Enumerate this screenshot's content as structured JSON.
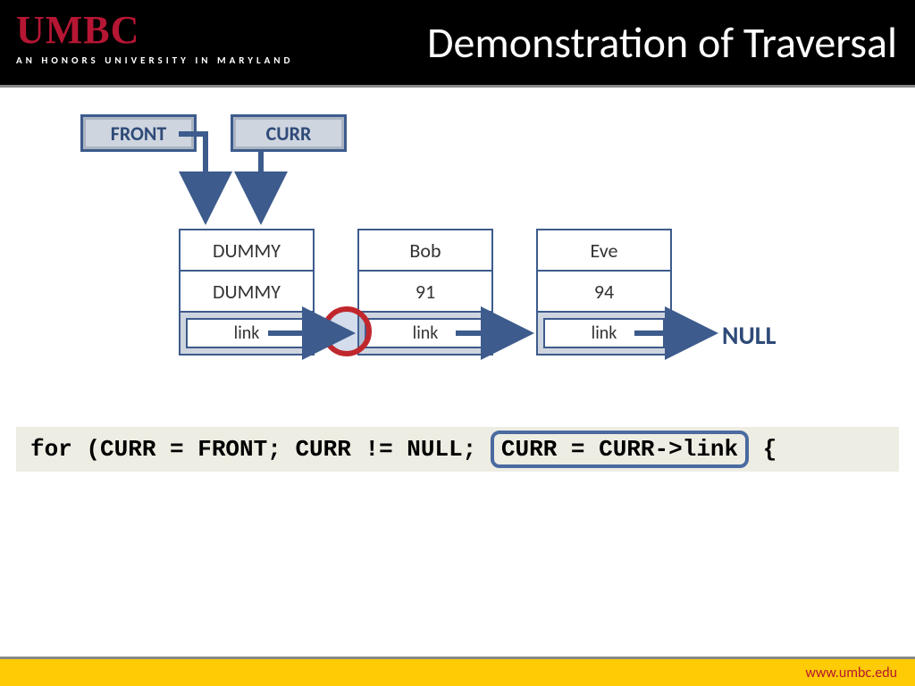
{
  "header": {
    "logo_main": "UMBC",
    "logo_sub": "AN HONORS UNIVERSITY IN MARYLAND",
    "title": "Demonstration of Traversal"
  },
  "pointers": {
    "front": "FRONT",
    "curr": "CURR"
  },
  "nodes": [
    {
      "name": "DUMMY",
      "value": "DUMMY",
      "link": "link"
    },
    {
      "name": "Bob",
      "value": "91",
      "link": "link"
    },
    {
      "name": "Eve",
      "value": "94",
      "link": "link"
    }
  ],
  "null_label": "NULL",
  "code": {
    "pre": "for (CURR = FRONT; CURR != NULL;",
    "hl": "CURR = CURR->link",
    "post": " {"
  },
  "footer": {
    "url": "www.umbc.edu"
  },
  "colors": {
    "accent": "#3d5b8c",
    "brand": "#b51633",
    "gold": "#ffcb05",
    "ring": "#c0272d"
  }
}
